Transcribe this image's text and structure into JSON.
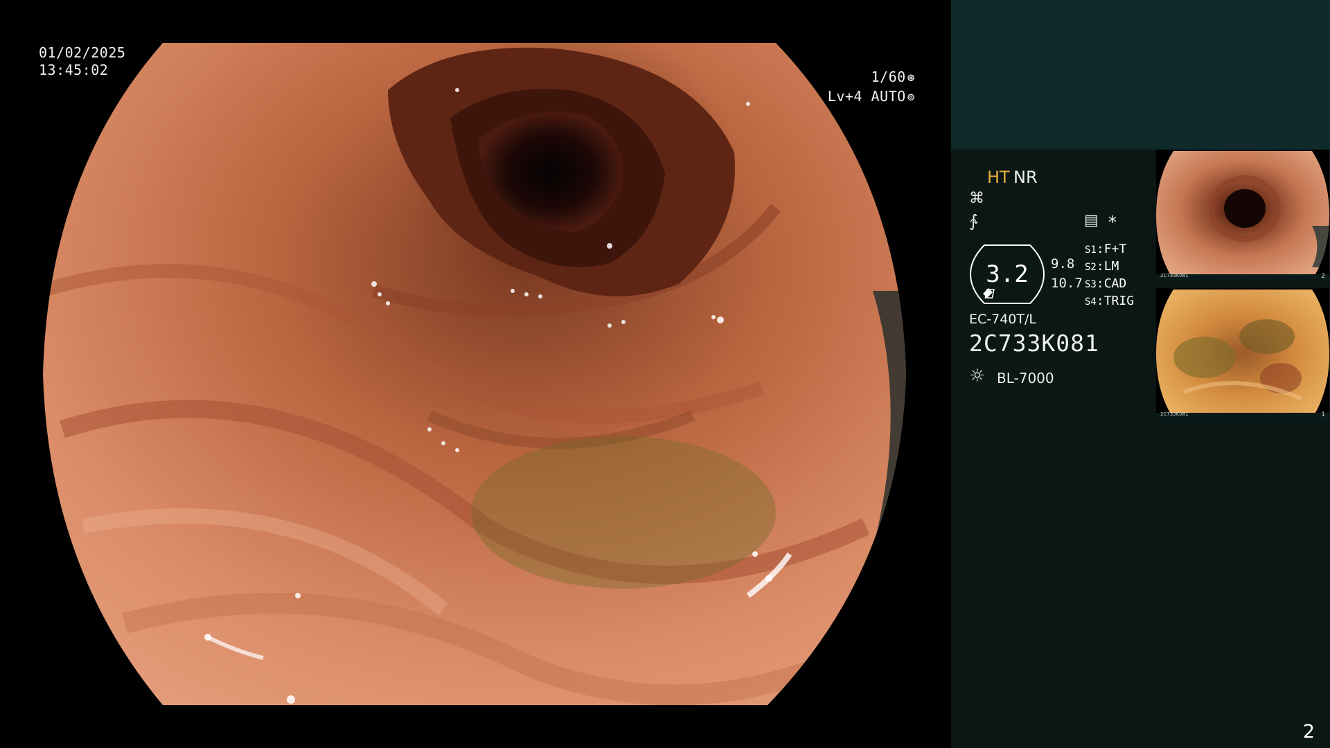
{
  "osd": {
    "date": "01/02/2025",
    "time": "13:45:02",
    "shutter": "1/60",
    "shutter_icon": "shutter-icon",
    "iris": "Lv+4 AUTO",
    "iris_icon": "iris-icon"
  },
  "panel": {
    "enhancement": "HT",
    "noise_reduction": "NR",
    "enhancement_mode_icon": "structure-enhance-icon",
    "color_mode_icon": "color-mode-icon",
    "menu_icon": "menu-icon",
    "star_icon": "asterisk-icon",
    "zoom": "3.2",
    "value_a": "9.8",
    "value_b": "10.7",
    "switches": [
      {
        "key": "S1",
        "value": "F+T"
      },
      {
        "key": "S2",
        "value": "LM"
      },
      {
        "key": "S3",
        "value": "CAD"
      },
      {
        "key": "S4",
        "value": "TRIG"
      }
    ],
    "scope_model": "EC-740T/L",
    "scope_serial": "2C733K081",
    "light_source": "BL-7000",
    "light_icon": "lamp-icon"
  },
  "thumbnails": [
    {
      "serial": "2C733K081",
      "number": "2"
    },
    {
      "serial": "2C733K081",
      "number": "1"
    }
  ],
  "page_number": "2",
  "colors": {
    "panel_top": "#0f2a28",
    "panel_bottom": "#0b1715",
    "ht_accent": "#e7b13c"
  }
}
